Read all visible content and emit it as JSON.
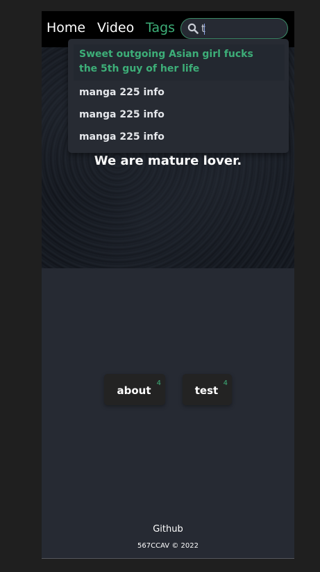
{
  "nav": {
    "home": "Home",
    "video": "Video",
    "tags": "Tags"
  },
  "search": {
    "value": "t",
    "icon": "search-icon"
  },
  "suggestions": [
    "Sweet outgoing Asian girl fucks the 5th guy of her life",
    "manga 225 info",
    "manga 225 info",
    "manga 225 info"
  ],
  "hero": {
    "title": "We are mature lover."
  },
  "tags": [
    {
      "label": "about",
      "count": "4"
    },
    {
      "label": "test",
      "count": "4"
    }
  ],
  "footer": {
    "link": "Github",
    "copyright": "567CCAV © 2022"
  },
  "colors": {
    "accent": "#3dae78",
    "background": "#262a33",
    "navbar": "#000000"
  }
}
